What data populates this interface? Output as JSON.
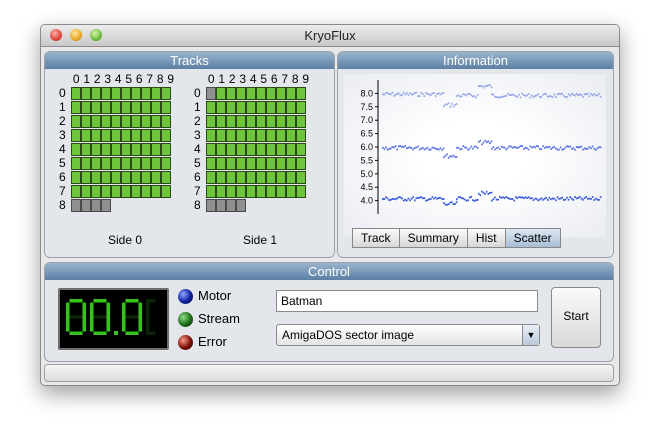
{
  "window": {
    "title": "KryoFlux"
  },
  "tracks": {
    "title": "Tracks",
    "col_numbers": [
      "0",
      "1",
      "2",
      "3",
      "4",
      "5",
      "6",
      "7",
      "8",
      "9"
    ],
    "row_numbers": [
      "0",
      "1",
      "2",
      "3",
      "4",
      "5",
      "6",
      "7",
      "8"
    ],
    "sides": [
      {
        "label": "Side 0",
        "off_cells": [
          [
            8,
            0
          ],
          [
            8,
            1
          ],
          [
            8,
            2
          ],
          [
            8,
            3
          ]
        ]
      },
      {
        "label": "Side 1",
        "off_cells": [
          [
            0,
            0
          ],
          [
            8,
            0
          ],
          [
            8,
            1
          ],
          [
            8,
            2
          ],
          [
            8,
            3
          ]
        ]
      }
    ],
    "colors": {
      "ok": "#6ec43a",
      "empty": "#8f8f8f"
    }
  },
  "information": {
    "title": "Information",
    "tabs": [
      "Track",
      "Summary",
      "Hist",
      "Scatter"
    ],
    "active_tab": "Scatter",
    "plot": {
      "y_ticks": [
        "8.0",
        "7.5",
        "7.0",
        "6.5",
        "6.0",
        "5.5",
        "5.0",
        "4.5",
        "4.0"
      ],
      "ylim": [
        3.5,
        8.5
      ],
      "bands": [
        {
          "segments": [
            [
              0,
              0.28,
              8.0
            ],
            [
              0.28,
              0.34,
              7.6
            ],
            [
              0.34,
              0.44,
              7.95
            ],
            [
              0.44,
              0.5,
              8.3
            ],
            [
              0.5,
              1.0,
              7.95
            ]
          ]
        },
        {
          "segments": [
            [
              0,
              0.28,
              6.0
            ],
            [
              0.28,
              0.34,
              5.7
            ],
            [
              0.34,
              0.44,
              6.0
            ],
            [
              0.44,
              0.5,
              6.2
            ],
            [
              0.5,
              1.0,
              6.0
            ]
          ]
        },
        {
          "segments": [
            [
              0,
              0.28,
              4.1
            ],
            [
              0.28,
              0.34,
              3.9
            ],
            [
              0.34,
              0.44,
              4.1
            ],
            [
              0.44,
              0.5,
              4.3
            ],
            [
              0.5,
              1.0,
              4.1
            ]
          ]
        }
      ],
      "point_color": "#1f45d8"
    }
  },
  "control": {
    "title": "Control",
    "led_digits": "00.0",
    "indicators": {
      "motor": "Motor",
      "stream": "Stream",
      "error": "Error"
    },
    "name_value": "Batman",
    "format_value": "AmigaDOS sector image",
    "start_label": "Start"
  }
}
